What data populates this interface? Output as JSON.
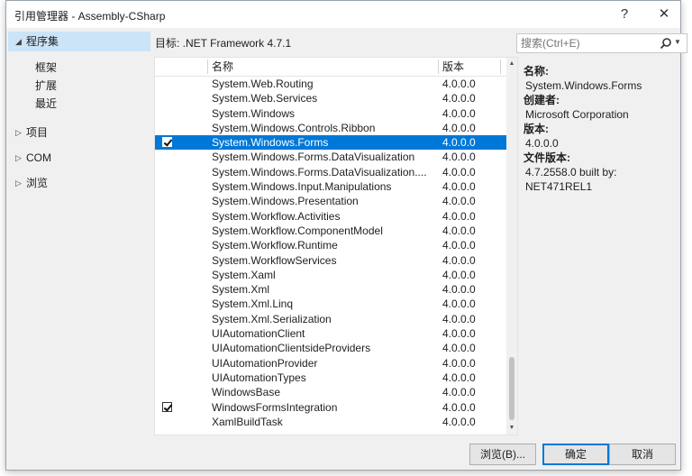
{
  "window": {
    "title": "引用管理器 - Assembly-CSharp",
    "help_glyph": "?",
    "close_glyph": "✕"
  },
  "nav": {
    "assemblies": "程序集",
    "sub_items": [
      "框架",
      "扩展",
      "最近"
    ],
    "projects": "项目",
    "com": "COM",
    "browse": "浏览"
  },
  "target_text": "目标: .NET Framework 4.7.1",
  "search": {
    "placeholder": "搜索(Ctrl+E)"
  },
  "list": {
    "col_name": "名称",
    "col_version": "版本",
    "rows": [
      {
        "name": "System.Web.Routing",
        "version": "4.0.0.0",
        "checked": false,
        "selected": false
      },
      {
        "name": "System.Web.Services",
        "version": "4.0.0.0",
        "checked": false,
        "selected": false
      },
      {
        "name": "System.Windows",
        "version": "4.0.0.0",
        "checked": false,
        "selected": false
      },
      {
        "name": "System.Windows.Controls.Ribbon",
        "version": "4.0.0.0",
        "checked": false,
        "selected": false
      },
      {
        "name": "System.Windows.Forms",
        "version": "4.0.0.0",
        "checked": true,
        "selected": true
      },
      {
        "name": "System.Windows.Forms.DataVisualization",
        "version": "4.0.0.0",
        "checked": false,
        "selected": false
      },
      {
        "name": "System.Windows.Forms.DataVisualization....",
        "version": "4.0.0.0",
        "checked": false,
        "selected": false
      },
      {
        "name": "System.Windows.Input.Manipulations",
        "version": "4.0.0.0",
        "checked": false,
        "selected": false
      },
      {
        "name": "System.Windows.Presentation",
        "version": "4.0.0.0",
        "checked": false,
        "selected": false
      },
      {
        "name": "System.Workflow.Activities",
        "version": "4.0.0.0",
        "checked": false,
        "selected": false
      },
      {
        "name": "System.Workflow.ComponentModel",
        "version": "4.0.0.0",
        "checked": false,
        "selected": false
      },
      {
        "name": "System.Workflow.Runtime",
        "version": "4.0.0.0",
        "checked": false,
        "selected": false
      },
      {
        "name": "System.WorkflowServices",
        "version": "4.0.0.0",
        "checked": false,
        "selected": false
      },
      {
        "name": "System.Xaml",
        "version": "4.0.0.0",
        "checked": false,
        "selected": false
      },
      {
        "name": "System.Xml",
        "version": "4.0.0.0",
        "checked": false,
        "selected": false
      },
      {
        "name": "System.Xml.Linq",
        "version": "4.0.0.0",
        "checked": false,
        "selected": false
      },
      {
        "name": "System.Xml.Serialization",
        "version": "4.0.0.0",
        "checked": false,
        "selected": false
      },
      {
        "name": "UIAutomationClient",
        "version": "4.0.0.0",
        "checked": false,
        "selected": false
      },
      {
        "name": "UIAutomationClientsideProviders",
        "version": "4.0.0.0",
        "checked": false,
        "selected": false
      },
      {
        "name": "UIAutomationProvider",
        "version": "4.0.0.0",
        "checked": false,
        "selected": false
      },
      {
        "name": "UIAutomationTypes",
        "version": "4.0.0.0",
        "checked": false,
        "selected": false
      },
      {
        "name": "WindowsBase",
        "version": "4.0.0.0",
        "checked": false,
        "selected": false
      },
      {
        "name": "WindowsFormsIntegration",
        "version": "4.0.0.0",
        "checked": true,
        "selected": false
      },
      {
        "name": "XamlBuildTask",
        "version": "4.0.0.0",
        "checked": false,
        "selected": false
      }
    ]
  },
  "details": {
    "name_label": "名称:",
    "name_value": "System.Windows.Forms",
    "creator_label": "创建者:",
    "creator_value": "Microsoft Corporation",
    "version_label": "版本:",
    "version_value": "4.0.0.0",
    "file_version_label": "文件版本:",
    "file_version_line1": "4.7.2558.0 built by:",
    "file_version_line2": "NET471REL1"
  },
  "buttons": {
    "browse": "浏览(B)...",
    "ok": "确定",
    "cancel": "取消"
  },
  "colors": {
    "selection": "#0078d7",
    "nav_selected": "#cce4f7",
    "dialog_bg": "#f0f0f0"
  }
}
